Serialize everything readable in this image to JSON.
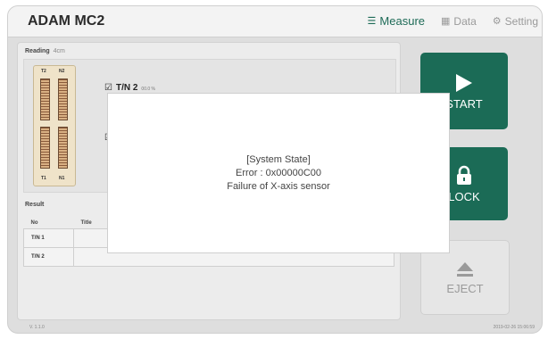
{
  "app": {
    "title": "ADAM MC2"
  },
  "nav": {
    "tabs": [
      {
        "label": "Measure",
        "icon": "list-icon",
        "active": true
      },
      {
        "label": "Data",
        "icon": "table-icon",
        "active": false
      },
      {
        "label": "Setting",
        "icon": "gear-icon",
        "active": false
      }
    ]
  },
  "reading": {
    "title": "Reading",
    "unit": "4cm",
    "sensor_labels": {
      "top_left": "T2",
      "top_right": "N2",
      "bottom_left": "T1",
      "bottom_right": "N1"
    },
    "items": [
      {
        "label": "T/N 2",
        "value": "00.0 %",
        "checked": true
      },
      {
        "label": "",
        "value": "",
        "checked": true
      }
    ]
  },
  "result": {
    "title": "Result",
    "columns": [
      "No",
      "Title"
    ],
    "rows": [
      {
        "no": "T/N 1",
        "title": ""
      },
      {
        "no": "T/N 2",
        "title": ""
      }
    ]
  },
  "buttons": {
    "start_label": "START",
    "lock_label": "LOCK",
    "eject_label": "EJECT"
  },
  "footer": {
    "version": "V. 1.1.0",
    "datetime": "2019-02-26 15:06:59"
  },
  "dialog": {
    "line1": "[System State]",
    "line2": "Error : 0x00000C00",
    "line3": "Failure of X-axis sensor"
  },
  "colors": {
    "accent": "#1b6b56",
    "panel": "#ececec",
    "background": "#dedede"
  }
}
